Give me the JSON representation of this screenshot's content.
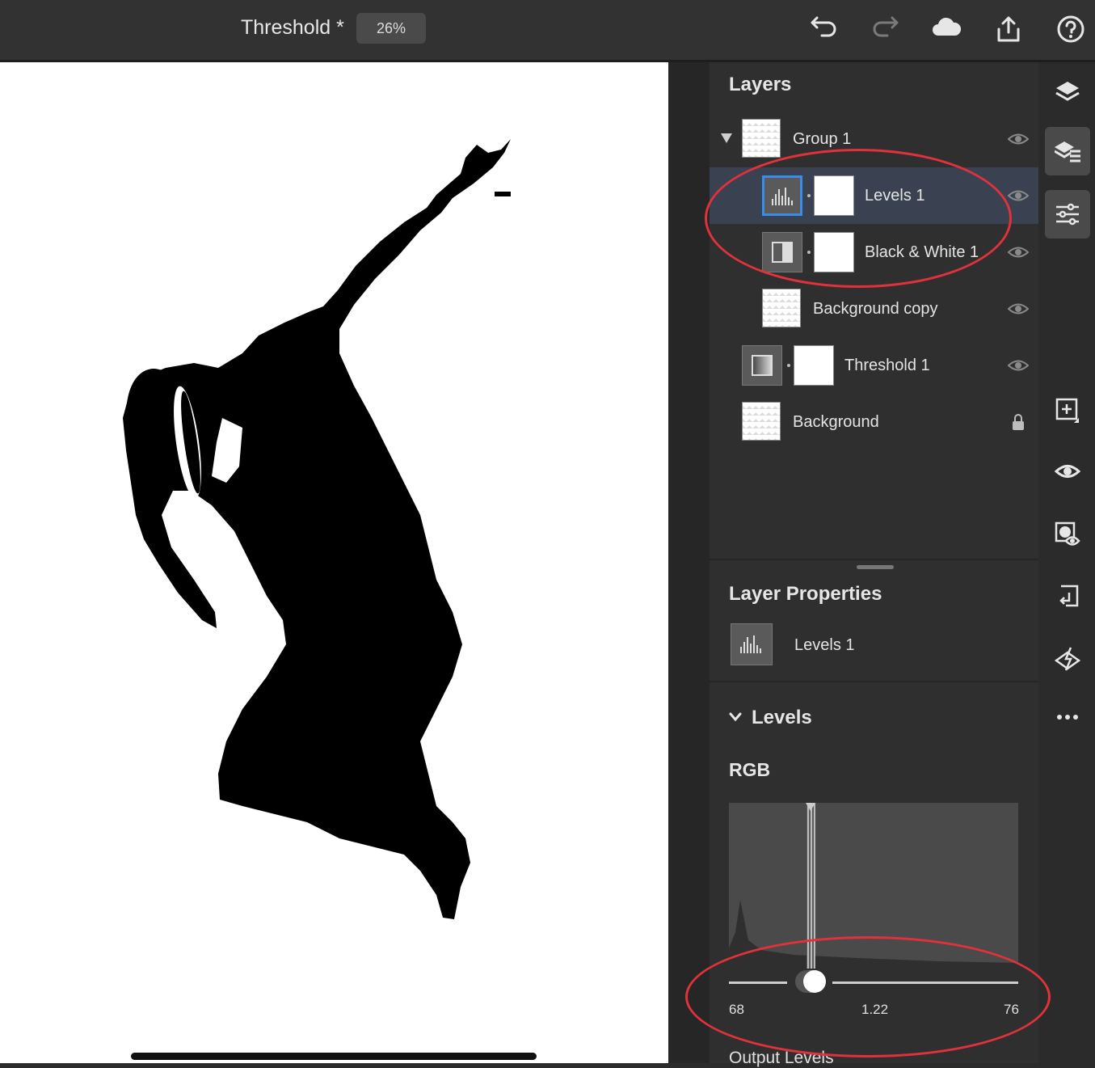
{
  "document": {
    "title": "Threshold *",
    "zoom": "26%"
  },
  "toolbar": {
    "icons": [
      "undo-icon",
      "redo-icon",
      "cloud-icon",
      "share-icon",
      "help-icon"
    ]
  },
  "layers_panel": {
    "title": "Layers",
    "layers": [
      {
        "label": "Group 1",
        "type": "group",
        "visible": true
      },
      {
        "label": "Levels 1",
        "type": "adjustment-levels",
        "visible": true,
        "selected": true
      },
      {
        "label": "Black & White 1",
        "type": "adjustment-bw",
        "visible": true
      },
      {
        "label": "Background copy",
        "type": "pixel",
        "visible": true
      },
      {
        "label": "Threshold 1",
        "type": "adjustment-threshold",
        "visible": true
      },
      {
        "label": "Background",
        "type": "pixel",
        "locked": true
      }
    ]
  },
  "layer_properties": {
    "title": "Layer Properties",
    "layer_name": "Levels 1"
  },
  "levels": {
    "section_title": "Levels",
    "channel": "RGB",
    "input_black": "68",
    "gamma": "1.22",
    "input_white": "76",
    "output_label": "Output Levels"
  },
  "rail": {
    "icons": [
      "layers-icon",
      "layer-list-icon",
      "adjustments-icon",
      "add-layer-icon",
      "visibility-icon",
      "mask-icon",
      "arrange-icon",
      "quick-actions-icon",
      "more-icon"
    ]
  },
  "colors": {
    "annotation": "#e0323b",
    "selection": "#3b8be8",
    "panel_bg": "#2f2f2f"
  }
}
